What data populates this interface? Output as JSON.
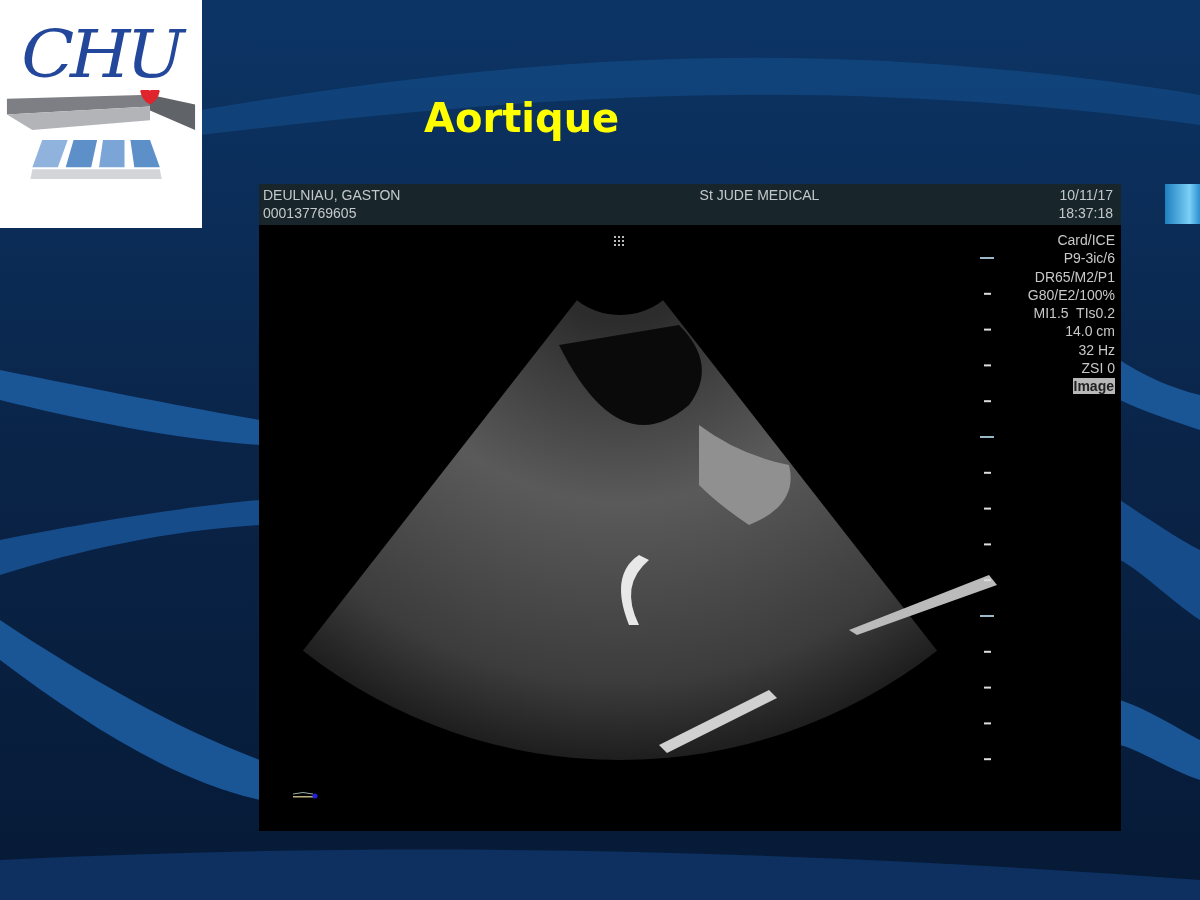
{
  "slide": {
    "title": "Aortique",
    "logo": {
      "text": "CHU"
    }
  },
  "scanner": {
    "patient_name": "DEULNIAU, GASTON",
    "patient_id": "000137769605",
    "institution": "St JUDE MEDICAL",
    "date": "10/11/17",
    "time": "18:37:18",
    "parameters": [
      "Card/ICE",
      "P9-3ic/6",
      "DR65/M2/P1",
      "G80/E2/100%",
      "MI1.5  TIs0.2",
      "14.0 cm",
      "32 Hz",
      "ZSI 0"
    ],
    "mode_label": "Image"
  }
}
